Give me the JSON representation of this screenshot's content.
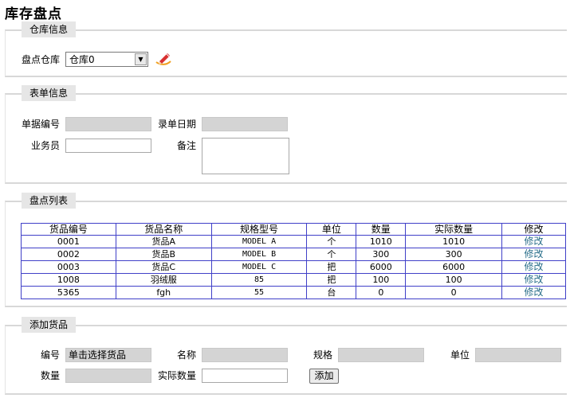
{
  "page": {
    "title": "库存盘点"
  },
  "warehouse": {
    "legend": "仓库信息",
    "label": "盘点仓库",
    "selected": "仓库0"
  },
  "form": {
    "legend": "表单信息",
    "doc_no_label": "单据编号",
    "doc_no_value": "",
    "date_label": "录单日期",
    "date_value": "",
    "salesman_label": "业务员",
    "salesman_value": "",
    "remark_label": "备注",
    "remark_value": ""
  },
  "list": {
    "legend": "盘点列表",
    "columns": [
      "货品编号",
      "货品名称",
      "规格型号",
      "单位",
      "数量",
      "实际数量",
      "修改"
    ],
    "rows": [
      [
        "0001",
        "货品A",
        "MODEL A",
        "个",
        "1010",
        "1010",
        "修改"
      ],
      [
        "0002",
        "货品B",
        "MODEL B",
        "个",
        "300",
        "300",
        "修改"
      ],
      [
        "0003",
        "货品C",
        "MODEL C",
        "把",
        "6000",
        "6000",
        "修改"
      ],
      [
        "1008",
        "羽绒服",
        "85",
        "把",
        "100",
        "100",
        "修改"
      ],
      [
        "5365",
        "fgh",
        "55",
        "台",
        "0",
        "0",
        "修改"
      ]
    ]
  },
  "add": {
    "legend": "添加货品",
    "code_label": "编号",
    "code_value": "单击选择货品",
    "name_label": "名称",
    "name_value": "",
    "spec_label": "规格",
    "spec_value": "",
    "unit_label": "单位",
    "unit_value": "",
    "qty_label": "数量",
    "qty_value": "",
    "actual_label": "实际数量",
    "actual_value": "",
    "add_button": "添加"
  },
  "colors": {
    "table_border": "#4040c8",
    "link": "#2a6f8a",
    "legend_bg": "#e6e6e6",
    "readonly_bg": "#d4d4d4"
  },
  "icons": {
    "warehouse_action": "pen-icon"
  }
}
